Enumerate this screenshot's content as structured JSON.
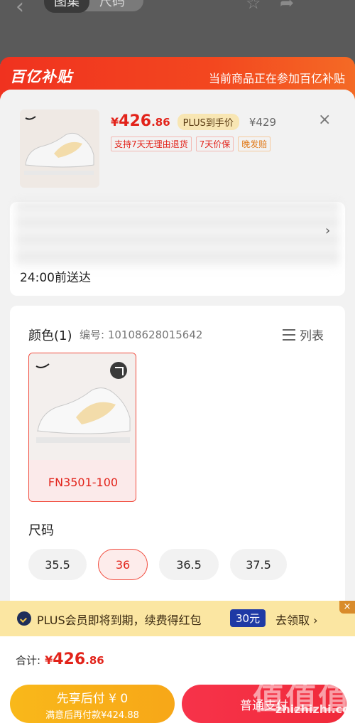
{
  "background": {
    "tab_active": "图集",
    "tab_other": "尺码"
  },
  "banner": {
    "logo_text": "百亿补贴",
    "info_text": "当前商品正在参加百亿补贴"
  },
  "product": {
    "price_yen": "¥",
    "price_int": "426",
    "price_dec": ".86",
    "plus_tag": "PLUS到手价",
    "original_price": "¥429",
    "close": "×",
    "tags": [
      "支持7天无理由退货",
      "7天价保",
      "晚发赔"
    ]
  },
  "delivery": {
    "text": "24:00前送达"
  },
  "specs": {
    "color_title": "颜色(1)",
    "color_code": "编号: 10108628015642",
    "list_label": "列表",
    "option_label": "FN3501-100",
    "size_title": "尺码",
    "sizes": [
      "35.5",
      "36",
      "36.5",
      "37.5"
    ],
    "selected_size": "36"
  },
  "plus_bar": {
    "text": "PLUS会员即将到期，续费得红包",
    "amount": "30元",
    "claim": "去领取 ›",
    "close": "×"
  },
  "footer": {
    "total_label": "合计:",
    "total_yen": "¥",
    "total_int": "426",
    "total_dec": ".86",
    "later_line1": "先享后付 ¥ 0",
    "later_line2": "满意后再付款¥424.88",
    "pay_label": "普通支付"
  },
  "watermark": {
    "text": "zhizhizhi.com",
    "mark": "值值值"
  },
  "colors": {
    "accent_red": "#e2231a",
    "plus_gold": "#fbe6a2",
    "later_button": "#f9b81a"
  }
}
